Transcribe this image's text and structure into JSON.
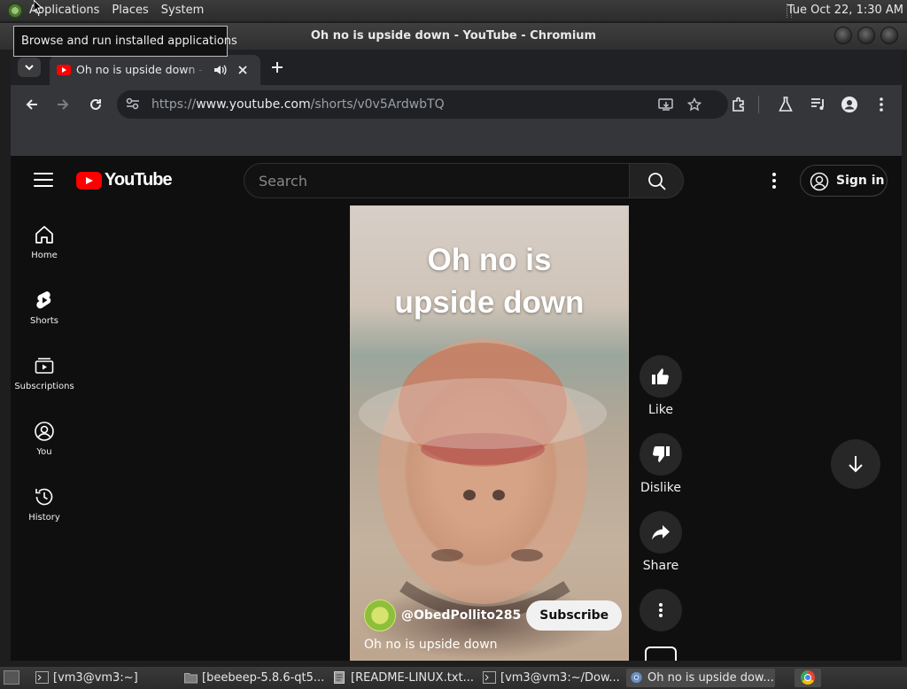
{
  "panel": {
    "menus": [
      "Applications",
      "Places",
      "System"
    ],
    "clock": "Tue Oct 22,  1:30 AM",
    "tooltip": "Browse and run installed applications"
  },
  "window": {
    "title": "Oh no is upside down - YouTube - Chromium"
  },
  "browser": {
    "tab_title": "Oh no is upside down - YouTube",
    "url_prefix": "https://",
    "url_host": "www.youtube.com",
    "url_path": "/shorts/v0v5ArdwbTQ"
  },
  "youtube": {
    "logo_text": "YouTube",
    "search_placeholder": "Search",
    "signin_label": "Sign in",
    "guide": [
      {
        "label": "Home",
        "icon": "home-icon"
      },
      {
        "label": "Shorts",
        "icon": "shorts-icon"
      },
      {
        "label": "Subscriptions",
        "icon": "subscriptions-icon"
      },
      {
        "label": "You",
        "icon": "you-icon"
      },
      {
        "label": "History",
        "icon": "history-icon"
      }
    ],
    "short": {
      "caption_line1": "Oh no is",
      "caption_line2": "upside down",
      "channel": "@ObedPollito285",
      "subscribe_label": "Subscribe",
      "video_title": "Oh no is upside down"
    },
    "actions": {
      "like": "Like",
      "dislike": "Dislike",
      "share": "Share"
    }
  },
  "taskbar": {
    "items": [
      "[vm3@vm3:~]",
      "[beebeep-5.8.6-qt5...",
      "[README-LINUX.txt...",
      "[vm3@vm3:~/Dow...",
      "Oh no is upside dow..."
    ]
  },
  "colors": {
    "youtube_red": "#ff0000",
    "page_bg": "#0f0f0f",
    "chrome_toolbar": "#35363a"
  }
}
